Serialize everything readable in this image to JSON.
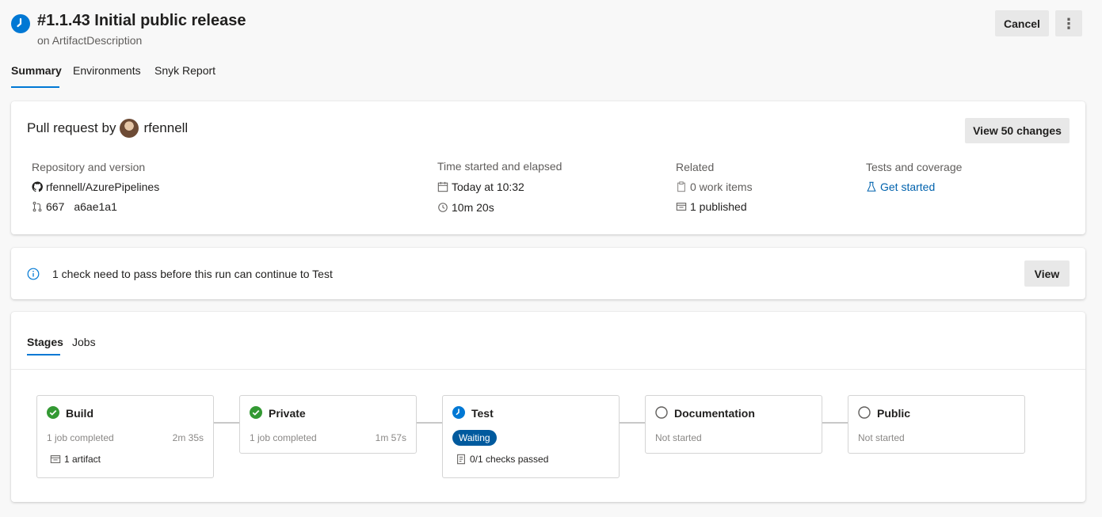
{
  "header": {
    "title": "#1.1.43 Initial public release",
    "subtitle": "on ArtifactDescription",
    "status_icon": "clock-icon",
    "cancel_label": "Cancel",
    "more_label": "⋮"
  },
  "tabs": [
    {
      "label": "Summary",
      "active": true
    },
    {
      "label": "Environments",
      "active": false
    },
    {
      "label": "Snyk Report",
      "active": false
    }
  ],
  "summary": {
    "pr_prefix": "Pull request by",
    "author": "rfennell",
    "view_changes_label": "View 50 changes",
    "repo": {
      "label": "Repository and version",
      "name": "rfennell/AzurePipelines",
      "pr_number": "667",
      "commit": "a6ae1a1"
    },
    "time": {
      "label": "Time started and elapsed",
      "started": "Today at 10:32",
      "elapsed": "10m 20s"
    },
    "related": {
      "label": "Related",
      "work_items": "0 work items",
      "published": "1 published"
    },
    "tests": {
      "label": "Tests and coverage",
      "link": "Get started"
    }
  },
  "check_notice": {
    "text": "1 check need to pass before this run can continue to Test",
    "view_label": "View"
  },
  "stages_section": {
    "tabs": [
      {
        "label": "Stages",
        "active": true
      },
      {
        "label": "Jobs",
        "active": false
      }
    ],
    "stages": [
      {
        "name": "Build",
        "status": "succeeded",
        "subtitle": "1 job completed",
        "duration": "2m 35s",
        "extra": "1 artifact"
      },
      {
        "name": "Private",
        "status": "succeeded",
        "subtitle": "1 job completed",
        "duration": "1m 57s"
      },
      {
        "name": "Test",
        "status": "waiting",
        "badge": "Waiting",
        "extra": "0/1 checks passed"
      },
      {
        "name": "Documentation",
        "status": "not-started",
        "subtitle": "Not started"
      },
      {
        "name": "Public",
        "status": "not-started",
        "subtitle": "Not started"
      }
    ]
  },
  "colors": {
    "accent": "#0078d4",
    "success": "#339933",
    "badge": "#005a9e"
  }
}
